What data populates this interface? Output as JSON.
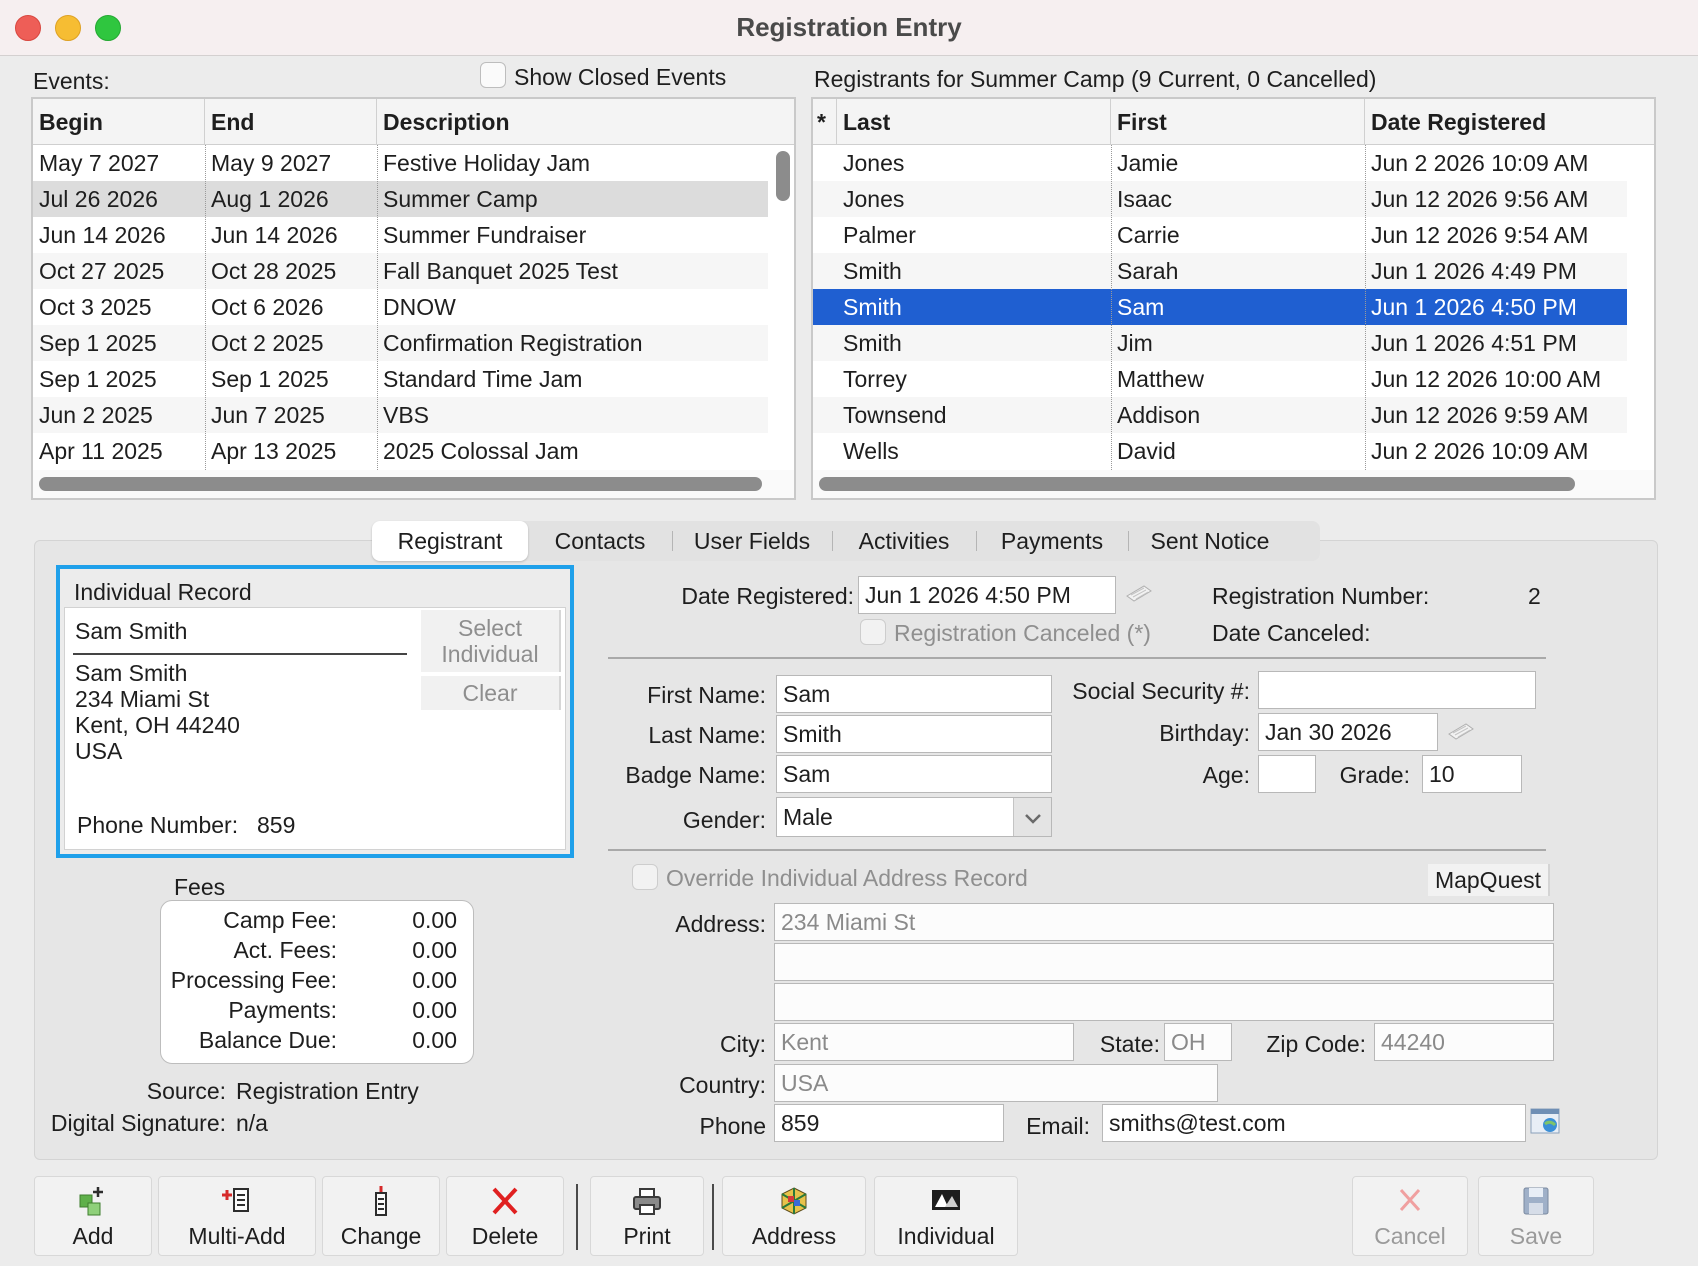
{
  "window": {
    "title": "Registration Entry"
  },
  "events": {
    "label": "Events:",
    "show_closed_label": "Show Closed Events",
    "columns": [
      "Begin",
      "End",
      "Description"
    ],
    "rows": [
      [
        "May 7 2027",
        "May 9 2027",
        "Festive Holiday Jam"
      ],
      [
        "Jul 26 2026",
        "Aug 1 2026",
        "Summer Camp"
      ],
      [
        "Jun 14 2026",
        "Jun 14 2026",
        "Summer Fundraiser"
      ],
      [
        "Oct 27 2025",
        "Oct 28 2025",
        "Fall Banquet 2025 Test"
      ],
      [
        "Oct 3 2025",
        "Oct 6 2026",
        "DNOW"
      ],
      [
        "Sep 1 2025",
        "Oct 2 2025",
        "Confirmation Registration"
      ],
      [
        "Sep 1 2025",
        "Sep 1 2025",
        "Standard Time Jam"
      ],
      [
        "Jun 2 2025",
        "Jun 7 2025",
        "VBS"
      ],
      [
        "Apr 11 2025",
        "Apr 13 2025",
        "2025 Colossal Jam"
      ]
    ]
  },
  "registrants": {
    "label": "Registrants for Summer Camp (9 Current, 0 Cancelled)",
    "columns": [
      "*",
      "Last",
      "First",
      "Date Registered"
    ],
    "rows": [
      [
        "Jones",
        "Jamie",
        "Jun 2 2026 10:09 AM"
      ],
      [
        "Jones",
        "Isaac",
        "Jun 12 2026 9:56 AM"
      ],
      [
        "Palmer",
        "Carrie",
        "Jun 12 2026 9:54 AM"
      ],
      [
        "Smith",
        "Sarah",
        "Jun 1 2026 4:49 PM"
      ],
      [
        "Smith",
        "Sam",
        "Jun 1 2026 4:50 PM"
      ],
      [
        "Smith",
        "Jim",
        "Jun 1 2026 4:51 PM"
      ],
      [
        "Torrey",
        "Matthew",
        "Jun 12 2026 10:00 AM"
      ],
      [
        "Townsend",
        "Addison",
        "Jun 12 2026 9:59 AM"
      ],
      [
        "Wells",
        "David",
        "Jun 2 2026 10:09 AM"
      ]
    ]
  },
  "tabs": [
    "Registrant",
    "Contacts",
    "User Fields",
    "Activities",
    "Payments",
    "Sent Notice"
  ],
  "individual": {
    "title": "Individual Record",
    "name": "Sam Smith",
    "address_lines": [
      "Sam Smith",
      "234 Miami St",
      "Kent, OH 44240",
      "USA"
    ],
    "select_label_1": "Select",
    "select_label_2": "Individual",
    "clear_label": "Clear",
    "phone_label": "Phone Number:",
    "phone": "859"
  },
  "fees": {
    "title": "Fees",
    "rows": [
      [
        "Camp Fee:",
        "0.00"
      ],
      [
        "Act. Fees:",
        "0.00"
      ],
      [
        "Processing Fee:",
        "0.00"
      ],
      [
        "Payments:",
        "0.00"
      ],
      [
        "Balance Due:",
        "0.00"
      ]
    ],
    "source_label": "Source:",
    "source": "Registration Entry",
    "signature_label": "Digital Signature:",
    "signature": "n/a"
  },
  "form": {
    "date_registered_label": "Date Registered:",
    "date_registered": "Jun 1 2026 4:50 PM",
    "reg_number_label": "Registration Number:",
    "reg_number": "2",
    "reg_canceled_label": "Registration Canceled (*)",
    "date_canceled_label": "Date Canceled:",
    "first_name_label": "First Name:",
    "first_name": "Sam",
    "last_name_label": "Last Name:",
    "last_name": "Smith",
    "badge_name_label": "Badge Name:",
    "badge_name": "Sam",
    "gender_label": "Gender:",
    "gender": "Male",
    "ssn_label": "Social Security #:",
    "ssn": "",
    "birthday_label": "Birthday:",
    "birthday": "Jan 30 2026",
    "age_label": "Age:",
    "age": "",
    "grade_label": "Grade:",
    "grade": "10",
    "override_label": "Override Individual Address Record",
    "mapquest_label": "MapQuest",
    "address_label": "Address:",
    "address1": "234 Miami St",
    "address2": "",
    "address3": "",
    "city_label": "City:",
    "city": "Kent",
    "state_label": "State:",
    "state": "OH",
    "zip_label": "Zip Code:",
    "zip": "44240",
    "country_label": "Country:",
    "country": "USA",
    "phone_label": "Phone",
    "phone": "859",
    "email_label": "Email:",
    "email": "smiths@test.com"
  },
  "toolbar": {
    "add": "Add",
    "multi_add": "Multi-Add",
    "change": "Change",
    "delete": "Delete",
    "print": "Print",
    "address": "Address",
    "individual": "Individual",
    "cancel": "Cancel",
    "save": "Save"
  },
  "colors": {
    "selection": "#1f5fd1",
    "focus_ring": "#1fa0ea",
    "row_highlight": "#dcdcdc",
    "delete_red": "#e02020"
  }
}
